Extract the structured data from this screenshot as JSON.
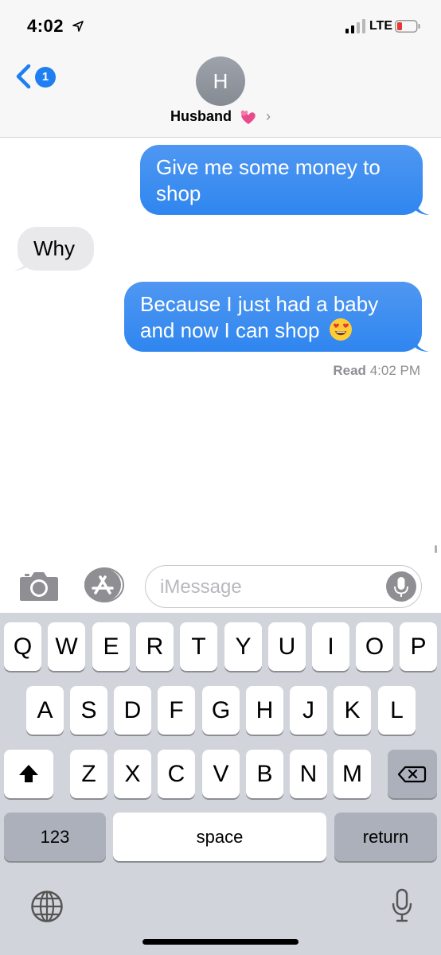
{
  "status_bar": {
    "time": "4:02",
    "network": "LTE",
    "icons": [
      "location-arrow-icon",
      "signal-icon",
      "battery-low-icon"
    ],
    "battery_color": "#e53935"
  },
  "header": {
    "back_badge": "1",
    "avatar_initial": "H",
    "contact_name": "Husband",
    "contact_emoji": "two-hearts-icon",
    "chevron": "›"
  },
  "messages": [
    {
      "direction": "outgoing",
      "text": "Give me some money to shop"
    },
    {
      "direction": "incoming",
      "text": "Why"
    },
    {
      "direction": "outgoing",
      "text": "Because I just had a baby and now I can shop",
      "emoji": "smiling-face-with-heart-eyes-icon"
    }
  ],
  "read_receipt": {
    "label": "Read",
    "time": "4:02 PM"
  },
  "input": {
    "placeholder": "iMessage"
  },
  "keyboard": {
    "row1": [
      "Q",
      "W",
      "E",
      "R",
      "T",
      "Y",
      "U",
      "I",
      "O",
      "P"
    ],
    "row2": [
      "A",
      "S",
      "D",
      "F",
      "G",
      "H",
      "J",
      "K",
      "L"
    ],
    "row3": [
      "Z",
      "X",
      "C",
      "V",
      "B",
      "N",
      "M"
    ],
    "numbers_key": "123",
    "space_key": "space",
    "return_key": "return"
  },
  "colors": {
    "accent": "#1e7ef2",
    "outgoing_bubble": "#3c8ef0",
    "incoming_bubble": "#e9e9eb",
    "keyboard_bg": "#d1d4da"
  }
}
